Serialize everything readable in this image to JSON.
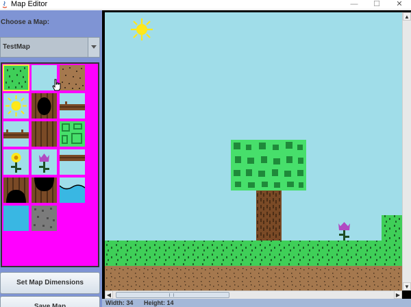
{
  "window": {
    "title": "Map Editor",
    "controls": [
      "minimize",
      "maximize",
      "close"
    ]
  },
  "sidebar": {
    "choose_label": "Choose a Map:",
    "map_select": {
      "value": "TestMap"
    },
    "palette": {
      "selected_index": 0,
      "tiles": [
        {
          "name": "grass"
        },
        {
          "name": "sky"
        },
        {
          "name": "dirt"
        },
        {
          "name": "sun"
        },
        {
          "name": "tree-hole"
        },
        {
          "name": "branch-right"
        },
        {
          "name": "branch-left"
        },
        {
          "name": "trunk"
        },
        {
          "name": "leaves"
        },
        {
          "name": "yellow-flower"
        },
        {
          "name": "purple-flower"
        },
        {
          "name": "branch-stub"
        },
        {
          "name": "trunk-cave-left"
        },
        {
          "name": "trunk-cave-right"
        },
        {
          "name": "water-edge"
        },
        {
          "name": "water"
        },
        {
          "name": "stone"
        }
      ]
    },
    "buttons": {
      "set_dimensions": "Set Map Dimensions",
      "save": "Save Map"
    }
  },
  "status": {
    "width": "Width: 34",
    "height": "Height: 14"
  },
  "colors": {
    "sky": "#a0dde9",
    "grass": "#3fcf58",
    "dirt": "#a5784e",
    "trunk": "#7a4a26",
    "leaves": "#47df6b",
    "palette_bg": "#ff00ff",
    "panel_bg": "#7f94d4",
    "sun": "#ffe81a"
  }
}
